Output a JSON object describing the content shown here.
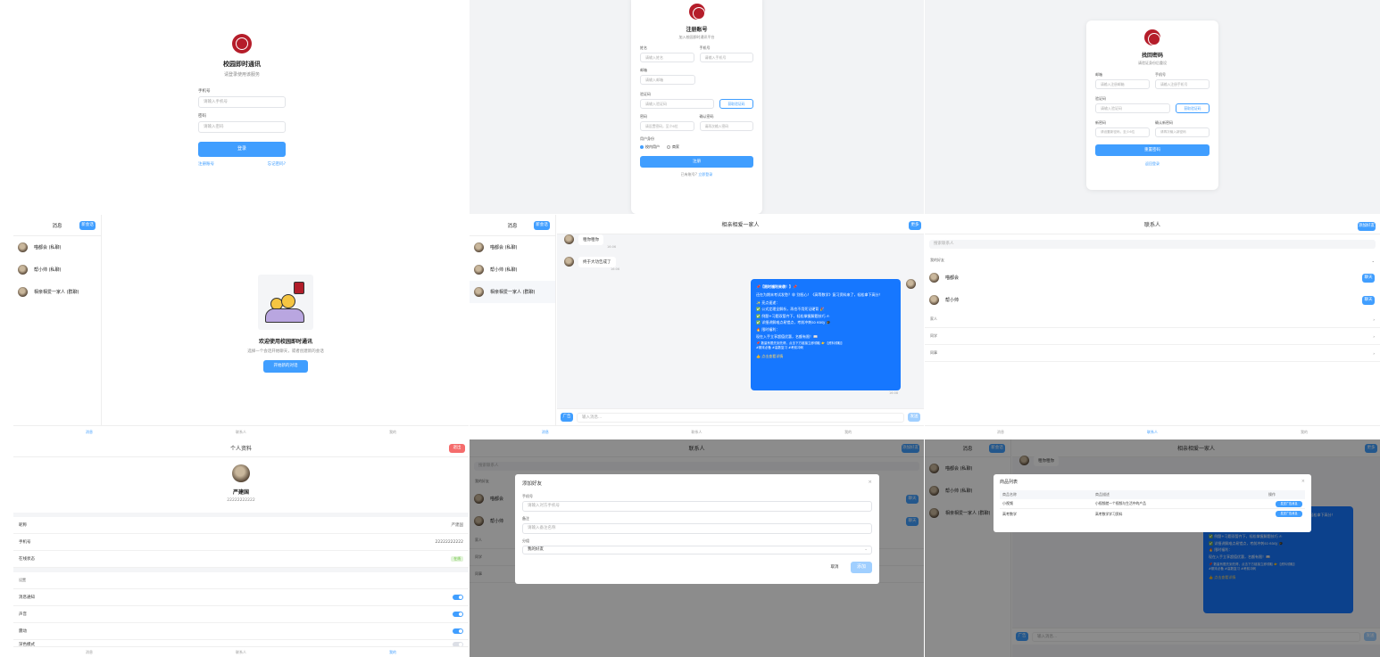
{
  "login": {
    "title": "校园即时通讯",
    "subtitle": "请登录使用该服务",
    "phone_label": "手机号",
    "phone_placeholder": "请输入手机号",
    "password_label": "密码",
    "password_placeholder": "请输入密码",
    "login_button": "登录",
    "register_link": "注册账号",
    "forgot_link": "忘记密码?"
  },
  "register": {
    "title": "注册账号",
    "subtitle": "加入校园即时通讯平台",
    "name_label": "姓名",
    "name_placeholder": "请输入姓名",
    "phone_label": "手机号",
    "phone_placeholder": "请输入手机号",
    "email_label": "邮箱",
    "email_placeholder": "请输入邮箱",
    "code_label": "验证码",
    "code_placeholder": "请输入验证码",
    "send_code_button": "获取验证码",
    "password_label": "密码",
    "password_placeholder": "请设置密码，至少6位",
    "confirm_label": "确认密码",
    "confirm_placeholder": "请再次输入密码",
    "role_label": "用户身份",
    "role_option_1": "校内用户",
    "role_option_2": "商家",
    "submit_button": "注册",
    "login_prompt": "已有账号?",
    "login_link": "立即登录"
  },
  "reset": {
    "title": "找回密码",
    "subtitle": "请验证身份后重设",
    "email_label": "邮箱",
    "email_placeholder": "请输入注册邮箱",
    "phone_label": "手机号",
    "phone_placeholder": "请输入注册手机号",
    "code_label": "验证码",
    "code_placeholder": "请输入验证码",
    "send_code_button": "获取验证码",
    "new_password_label": "新密码",
    "new_password_placeholder": "请设置新密码，至少6位",
    "confirm_label": "确认新密码",
    "confirm_placeholder": "请再次输入新密码",
    "submit_button": "重置密码",
    "back_link": "返回登录"
  },
  "messages": {
    "header": "消息",
    "new_chat_button": "新会话",
    "conversations": [
      {
        "name": "喵都会 (私聊)"
      },
      {
        "name": "帮小帅 (私聊)"
      },
      {
        "name": "相亲相爱一家人 (群聊)"
      }
    ],
    "welcome_title": "欢迎使用校园即时通讯",
    "welcome_text": "选择一个会话开始聊天，或者创建新的会话",
    "start_button": "开始新的对话"
  },
  "chat": {
    "title": "相亲相爱一家人",
    "more_button": "更多",
    "msg1": "租你租你",
    "msg1_time": "16:06",
    "msg2": "终于大功告成了",
    "msg2_time": "16:06",
    "promo_lines": [
      "📌【限时福利来袭！】📌",
      "还在为期末考试发愁？😩 别担心！《高等数学》复习资料来了，轻松拿下高分！",
      "✨ 亮点速递：",
      "✅ 公式定理全解析，再也不用死记硬背 🎉",
      "✅ 例题+习题双管齐下，轻松掌握解题技巧 ✍",
      "✅ 详细讲解难点易错点，考前冲刺so easy 🎓",
      "🔥 限时福利：",
      "现在入手立享超值优惠，名额有限！📖",
      "📌 数量有限先到先得，点击下方链接立即领取 👉【资料领取】",
      "#期末必备 #高数复习 #考前冲刺",
      "👍 点击查看详情"
    ],
    "promo_time": "16:08",
    "ad_button": "广告",
    "input_placeholder": "输入消息...",
    "send_button": "发送"
  },
  "contacts": {
    "header": "联系人",
    "add_button": "添加好友",
    "search_placeholder": "搜索联系人",
    "my_friends": "我的好友",
    "friends": [
      {
        "name": "喵都会",
        "action": "聊天"
      },
      {
        "name": "帮小帅",
        "action": "聊天"
      }
    ],
    "groups": [
      "家人",
      "同学",
      "同事"
    ]
  },
  "profile": {
    "header": "个人资料",
    "logout_button": "退出",
    "name": "严建国",
    "id": "22222222222",
    "nickname_label": "昵称",
    "nickname_value": "严建国",
    "phone_label": "手机号",
    "phone_value": "22222222222",
    "status_label": "在线状态",
    "status_value": "在线",
    "settings_label": "设置",
    "notify_label": "消息通知",
    "sound_label": "声音",
    "vibrate_label": "震动",
    "dark_label": "深色模式"
  },
  "tabs": {
    "messages": "消息",
    "contacts": "联系人",
    "profile": "我的"
  },
  "add_friend_dialog": {
    "title": "添加好友",
    "phone_label": "手机号",
    "phone_placeholder": "请输入对方手机号",
    "remark_label": "备注",
    "remark_placeholder": "请输入备注名称",
    "group_label": "分组",
    "group_value": "我的好友",
    "cancel_button": "取消",
    "confirm_button": "添加"
  },
  "products_dialog": {
    "title": "商品列表",
    "col_name": "商品名称",
    "col_desc": "商品描述",
    "col_action": "操作",
    "rows": [
      {
        "name": "小视频",
        "desc": "小视频就一个视频与生活中的产品",
        "action": "发送广告消息"
      },
      {
        "name": "高考数学",
        "desc": "高考数学学习资料",
        "action": "发送广告消息"
      }
    ]
  },
  "colors": {
    "primary": "#409eff",
    "danger": "#f56c6c",
    "brand": "#b51d2a",
    "promo": "#1677ff"
  }
}
